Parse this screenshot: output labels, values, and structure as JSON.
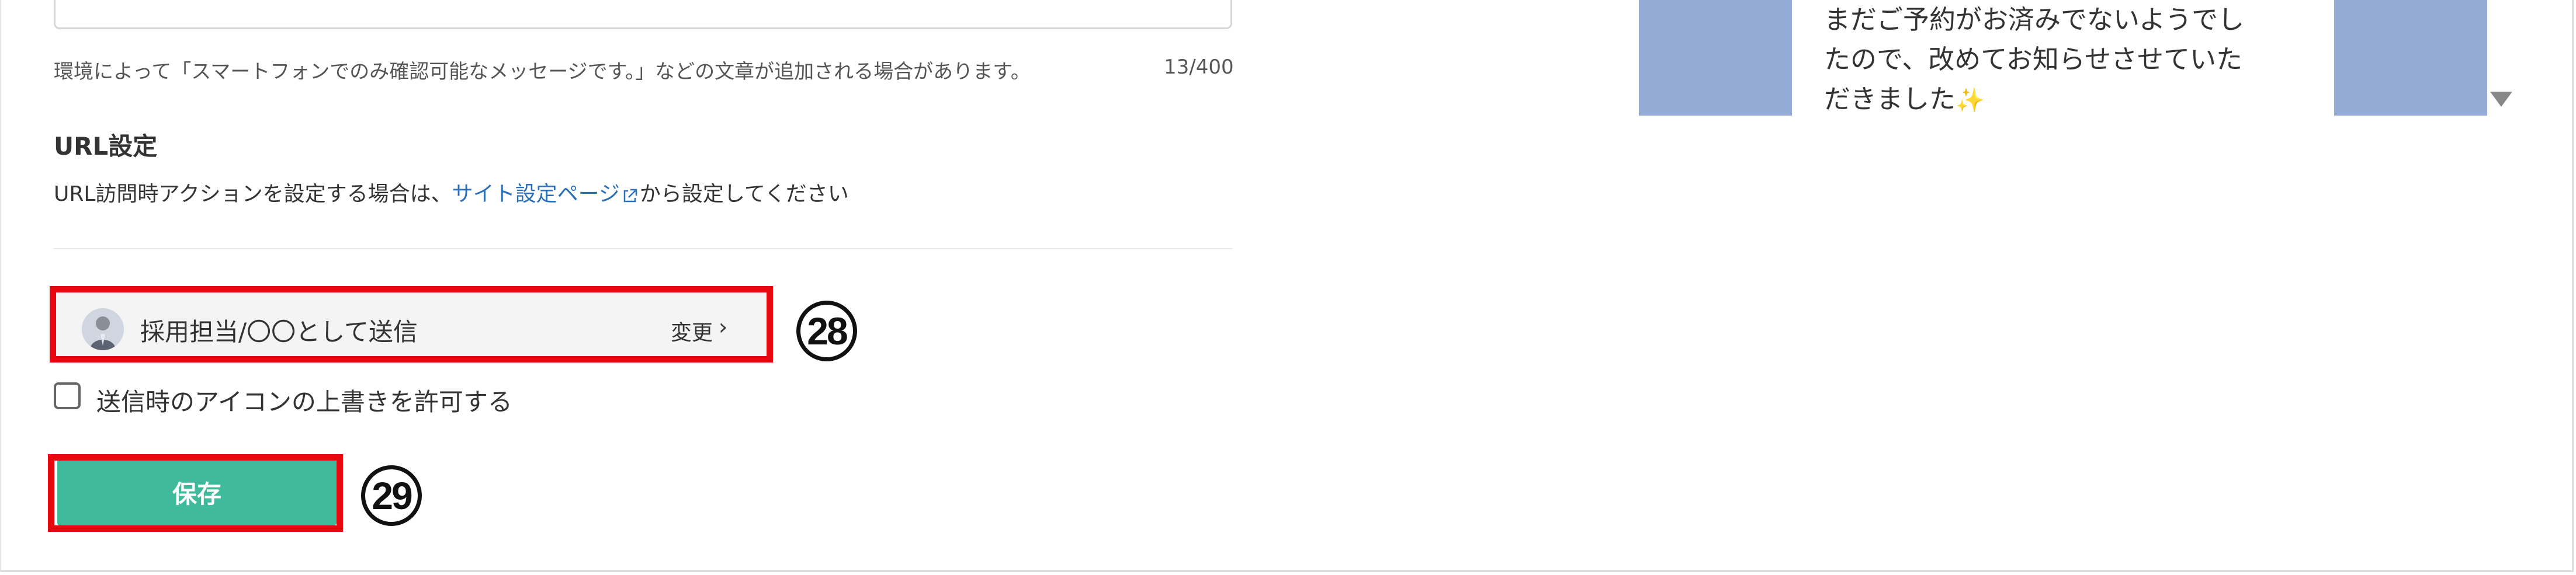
{
  "message_settings": {
    "note": "環境によって「スマートフォンでのみ確認可能なメッセージです。」などの文章が追加される場合があります。",
    "char_counter": "13/400"
  },
  "url_settings": {
    "title": "URL設定",
    "desc_prefix": "URL訪問時アクションを設定する場合は、",
    "link_text": "サイト設定ページ",
    "desc_suffix": "から設定してください"
  },
  "sender": {
    "label": "採用担当/〇〇として送信",
    "change_label": "変更",
    "chevron": "›",
    "annotation": "28"
  },
  "override_icon": {
    "label": "送信時のアイコンの上書きを許可する",
    "checked": false
  },
  "save": {
    "label": "保存",
    "annotation": "29"
  },
  "preview": {
    "lines": [
      "まだご予約がお済みでないようでし",
      "たので、改めてお知らせさせていた",
      "だきました"
    ],
    "emoji": "✨"
  },
  "colors": {
    "accent_green": "#3fba9a",
    "highlight_red": "#e8090f",
    "link_blue": "#2b6fb8",
    "preview_blue": "#93abd5"
  }
}
